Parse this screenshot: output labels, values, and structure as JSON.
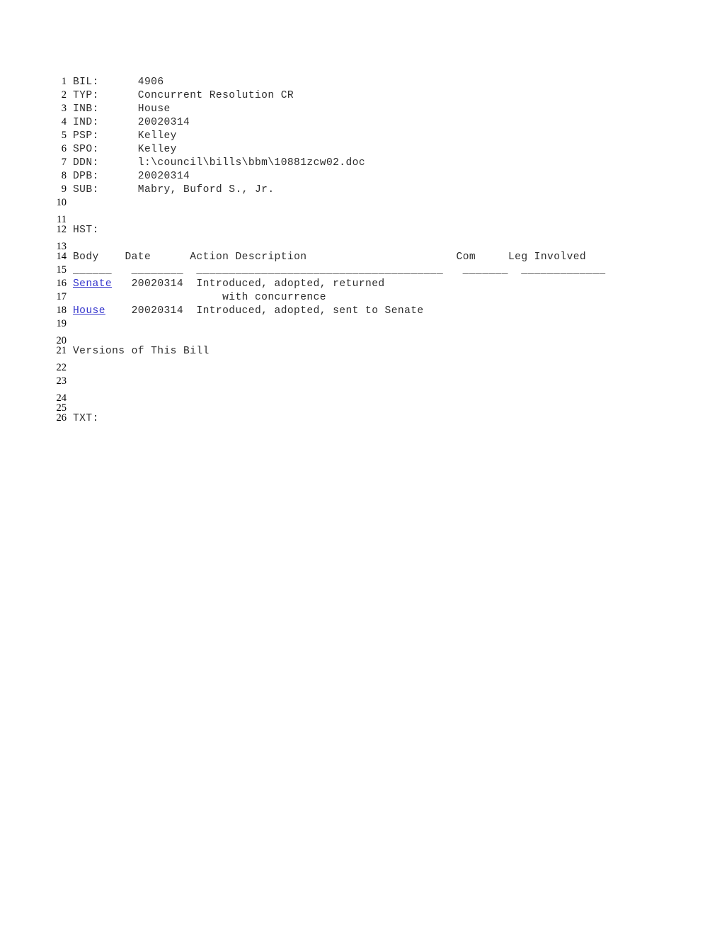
{
  "document": {
    "fields": [
      {
        "line": "1",
        "key": "BIL:",
        "value": "4906"
      },
      {
        "line": "2",
        "key": "TYP:",
        "value": "Concurrent Resolution CR"
      },
      {
        "line": "3",
        "key": "INB:",
        "value": "House"
      },
      {
        "line": "4",
        "key": "IND:",
        "value": "20020314"
      },
      {
        "line": "5",
        "key": "PSP:",
        "value": "Kelley"
      },
      {
        "line": "6",
        "key": "SPO:",
        "value": "Kelley"
      },
      {
        "line": "7",
        "key": "DDN:",
        "value": "l:\\council\\bills\\bbm\\10881zcw02.doc"
      },
      {
        "line": "8",
        "key": "DPB:",
        "value": "20020314"
      },
      {
        "line": "9",
        "key": "SUB:",
        "value": "Mabry, Buford S., Jr."
      }
    ],
    "history_label": "HST:",
    "history_table": {
      "columns": [
        "Body",
        "Date",
        "Action Description",
        "Com",
        "Leg Involved"
      ],
      "separator": "______   ________  ______________________________________   _______  _____________",
      "rows": [
        {
          "line": "16",
          "body": "Senate",
          "body_is_link": true,
          "date": "20020314",
          "action": "Introduced, adopted, returned",
          "com": "",
          "leg_involved": ""
        },
        {
          "line": "17",
          "body": "",
          "body_is_link": false,
          "date": "",
          "action": "with concurrence",
          "com": "",
          "leg_involved": ""
        },
        {
          "line": "18",
          "body": "House",
          "body_is_link": true,
          "date": "20020314",
          "action": "Introduced, adopted, sent to Senate",
          "com": "",
          "leg_involved": ""
        }
      ]
    },
    "versions_heading": "Versions of This Bill",
    "text_label": "TXT:",
    "line_numbers": [
      "1",
      "2",
      "3",
      "4",
      "5",
      "6",
      "7",
      "8",
      "9",
      "10",
      "11",
      "12",
      "13",
      "14",
      "15",
      "16",
      "17",
      "18",
      "19",
      "20",
      "21",
      "22",
      "23",
      "24",
      "25",
      "26"
    ],
    "colors": {
      "link": "#3333cc",
      "text": "#2b2b2b",
      "line_number": "#000000",
      "background": "#ffffff"
    }
  }
}
